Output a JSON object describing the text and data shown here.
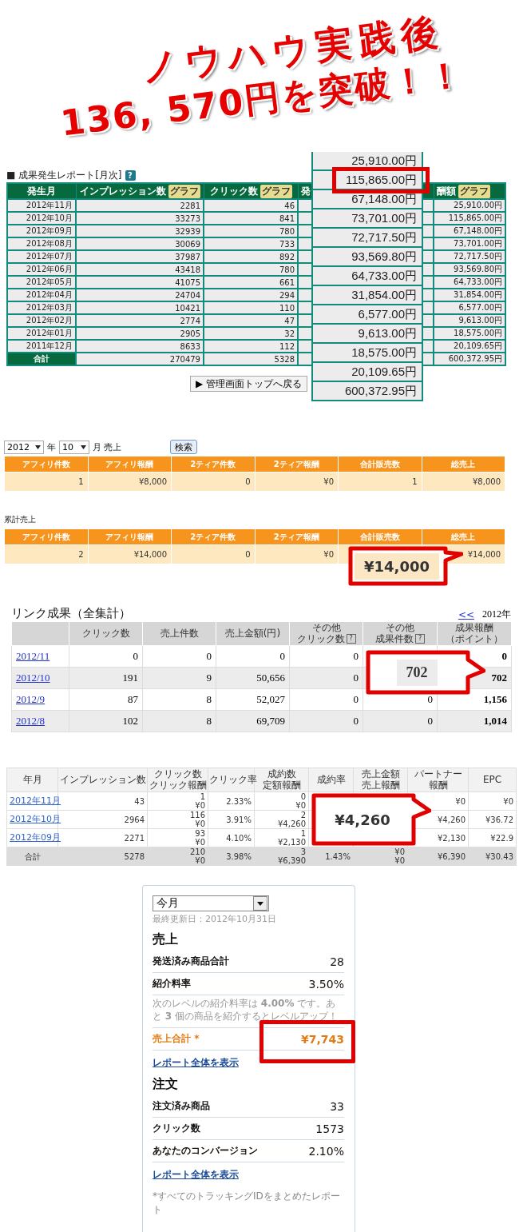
{
  "headline": {
    "lines": [
      "ノウハウ実践後",
      "136, 570円を突破！！"
    ]
  },
  "monthly_report": {
    "title": "■ 成果発生レポート[月次]",
    "help_mark": "?",
    "columns": [
      {
        "label": "発生月"
      },
      {
        "label": "インプレッション数",
        "graph_button": "グラフ"
      },
      {
        "label": "クリック数",
        "graph_button": "グラフ"
      },
      {
        "label": "発"
      },
      {
        "label": "酬額",
        "graph_button": "グラフ"
      }
    ],
    "rows": [
      {
        "month": "2012年11月",
        "impressions": "2281",
        "clicks": "46",
        "reward": "25,910.00円"
      },
      {
        "month": "2012年10月",
        "impressions": "33273",
        "clicks": "841",
        "reward": "115,865.00円"
      },
      {
        "month": "2012年09月",
        "impressions": "32939",
        "clicks": "780",
        "reward": "67,148.00円"
      },
      {
        "month": "2012年08月",
        "impressions": "30069",
        "clicks": "733",
        "reward": "73,701.00円"
      },
      {
        "month": "2012年07月",
        "impressions": "37987",
        "clicks": "892",
        "reward": "72,717.50円"
      },
      {
        "month": "2012年06月",
        "impressions": "43418",
        "clicks": "780",
        "reward": "93,569.80円"
      },
      {
        "month": "2012年05月",
        "impressions": "41075",
        "clicks": "661",
        "reward": "64,733.00円"
      },
      {
        "month": "2012年04月",
        "impressions": "24704",
        "clicks": "294",
        "reward": "31,854.00円"
      },
      {
        "month": "2012年03月",
        "impressions": "10421",
        "clicks": "110",
        "reward": "6,577.00円"
      },
      {
        "month": "2012年02月",
        "impressions": "2774",
        "clicks": "47",
        "reward": "9,613.00円"
      },
      {
        "month": "2012年01月",
        "impressions": "2905",
        "clicks": "32",
        "reward": "18,575.00円"
      },
      {
        "month": "2011年12月",
        "impressions": "8633",
        "clicks": "112",
        "reward": "20,109.65円"
      }
    ],
    "total": {
      "month": "合計",
      "impressions": "270479",
      "clicks": "5328",
      "reward": "600,372.95円"
    },
    "zoomed_amounts": [
      {
        "value": "25,910.00円",
        "highlighted": false
      },
      {
        "value": "115,865.00円",
        "highlighted": true
      },
      {
        "value": "67,148.00円",
        "highlighted": false
      },
      {
        "value": "73,701.00円",
        "highlighted": false
      },
      {
        "value": "72,717.50円",
        "highlighted": false
      },
      {
        "value": "93,569.80円",
        "highlighted": false
      },
      {
        "value": "64,733.00円",
        "highlighted": false
      },
      {
        "value": "31,854.00円",
        "highlighted": false
      },
      {
        "value": "6,577.00円",
        "highlighted": false
      },
      {
        "value": "9,613.00円",
        "highlighted": false
      },
      {
        "value": "18,575.00円",
        "highlighted": false
      },
      {
        "value": "20,109.65円",
        "highlighted": false
      },
      {
        "value": "600,372.95円",
        "highlighted": false
      }
    ],
    "back_button": "▶ 管理画面トップへ戻る"
  },
  "monthly_sales": {
    "year_select": "2012",
    "year_label": "年",
    "month_select": "10",
    "month_label": "月 売上",
    "search_button": "検索",
    "columns": [
      "アフィリ件数",
      "アフィリ報酬",
      "2ティア件数",
      "2ティア報酬",
      "合計販売数",
      "総売上"
    ],
    "rows": [
      {
        "affiliate_count": "1",
        "affiliate_reward": "¥8,000",
        "tier2_count": "0",
        "tier2_reward": "¥0",
        "total_sold": "1",
        "total_sales": "¥8,000"
      }
    ]
  },
  "cumulative_sales": {
    "title": "累計売上",
    "columns": [
      "アフィリ件数",
      "アフィリ報酬",
      "2ティア件数",
      "2ティア報酬",
      "合計販売数",
      "総売上"
    ],
    "rows": [
      {
        "affiliate_count": "2",
        "affiliate_reward": "¥14,000",
        "tier2_count": "0",
        "tier2_reward": "¥0",
        "total_sales": "¥14,000"
      }
    ],
    "callout": "¥14,000"
  },
  "link_results": {
    "title": "リンク成果（全集計）",
    "prev_link": "<<",
    "year": "2012年",
    "columns": [
      {
        "lines": [
          "クリック数"
        ]
      },
      {
        "lines": [
          "売上件数"
        ]
      },
      {
        "lines": [
          "売上金額(円)"
        ]
      },
      {
        "lines": [
          "その他",
          "クリック数"
        ],
        "help_mark": "?"
      },
      {
        "lines": [
          "その他",
          "成果件数"
        ],
        "help_mark": "?"
      },
      {
        "lines": [
          "成果報酬",
          "（ポイント）"
        ]
      }
    ],
    "rows": [
      {
        "period": "2012/11",
        "clicks": "0",
        "sales_count": "0",
        "sales_amount": "0",
        "other_clicks": "0",
        "reward": "0"
      },
      {
        "period": "2012/10",
        "clicks": "191",
        "sales_count": "9",
        "sales_amount": "50,656",
        "other_clicks": "0",
        "reward": "702"
      },
      {
        "period": "2012/9",
        "clicks": "87",
        "sales_count": "8",
        "sales_amount": "52,027",
        "other_clicks": "0",
        "other_results": "0",
        "reward": "1,156"
      },
      {
        "period": "2012/8",
        "clicks": "102",
        "sales_count": "8",
        "sales_amount": "69,709",
        "other_clicks": "0",
        "other_results": "0",
        "reward": "1,014"
      }
    ],
    "callout": "702"
  },
  "partner_report": {
    "columns": [
      {
        "lines": [
          "年月"
        ]
      },
      {
        "lines": [
          "インプレッション数"
        ]
      },
      {
        "lines": [
          "クリック数",
          "クリック報酬"
        ]
      },
      {
        "lines": [
          "クリック率"
        ]
      },
      {
        "lines": [
          "成約数",
          "定額報酬"
        ]
      },
      {
        "lines": [
          "成約率"
        ]
      },
      {
        "lines": [
          "売上金額",
          "売上報酬"
        ]
      },
      {
        "lines": [
          "パートナー",
          "報酬"
        ]
      },
      {
        "lines": [
          "EPC"
        ]
      }
    ],
    "rows": [
      {
        "period": "2012年11月",
        "impressions": "43",
        "clicks": {
          "lines": [
            "1",
            "¥0"
          ]
        },
        "click_rate": "2.33%",
        "conversions": {
          "lines": [
            "0",
            "¥0"
          ]
        },
        "partner_reward": "¥0",
        "epc": "¥0"
      },
      {
        "period": "2012年10月",
        "impressions": "2964",
        "clicks": {
          "lines": [
            "116",
            "¥0"
          ]
        },
        "click_rate": "3.91%",
        "conversions": {
          "lines": [
            "2",
            "¥4,260"
          ]
        },
        "partner_reward": "¥4,260",
        "epc": "¥36.72"
      },
      {
        "period": "2012年09月",
        "impressions": "2271",
        "clicks": {
          "lines": [
            "93",
            "¥0"
          ]
        },
        "click_rate": "4.10%",
        "conversions": {
          "lines": [
            "1",
            "¥2,130"
          ]
        },
        "partner_reward": "¥2,130",
        "epc": "¥22.9"
      }
    ],
    "total": {
      "label": "合計",
      "impressions": "5278",
      "clicks": {
        "lines": [
          "210",
          "¥0"
        ]
      },
      "click_rate": "3.98%",
      "conversions": {
        "lines": [
          "3",
          "¥6,390"
        ]
      },
      "conversion_rate": "1.43%",
      "sales": {
        "lines": [
          "¥0",
          "¥0"
        ]
      },
      "partner_reward": "¥6,390",
      "epc": "¥30.43"
    },
    "callout": "¥4,260"
  },
  "sales_widget": {
    "period_select": "今月",
    "updated": "最終更新日：2012年10月31日",
    "sections": [
      {
        "heading": "売上",
        "items": [
          {
            "kind": "stat",
            "label": "発送済み商品合計",
            "value": "28"
          },
          {
            "kind": "stat",
            "label": "紹介料率",
            "value": "3.50%"
          },
          {
            "kind": "note",
            "text": "次のレベルの紹介料率は **4.00%** です。あと **3** 個の商品を紹介するとレベルアップ！"
          },
          {
            "kind": "total",
            "label": "売上合計 *",
            "value": "¥7,743",
            "highlighted": true
          }
        ],
        "link": "レポート全体を表示"
      },
      {
        "heading": "注文",
        "items": [
          {
            "kind": "stat",
            "label": "注文済み商品",
            "value": "33"
          },
          {
            "kind": "stat",
            "label": "クリック数",
            "value": "1573"
          },
          {
            "kind": "stat",
            "label": "あなたのコンバージョン",
            "value": "2.10%"
          }
        ],
        "link": "レポート全体を表示"
      }
    ],
    "footnote": "*すべてのトラッキングIDをまとめたレポート"
  }
}
